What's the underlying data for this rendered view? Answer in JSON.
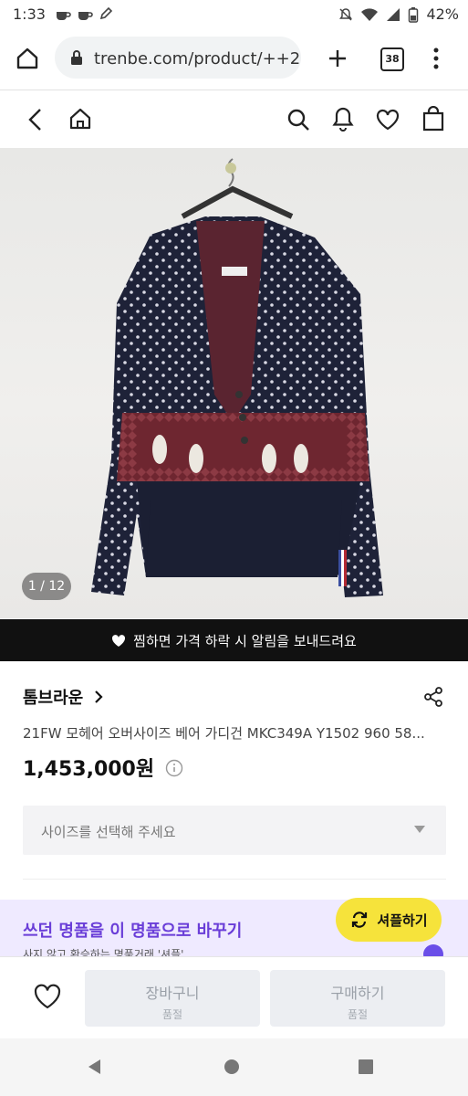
{
  "status_bar": {
    "time": "1:33",
    "battery": "42%",
    "left_icons": [
      "coffee-icon",
      "coffee-icon",
      "pencil-icon"
    ],
    "right_icons": [
      "mute-icon",
      "wifi-icon",
      "signal-icon",
      "battery-icon"
    ]
  },
  "browser": {
    "url": "trenbe.com/product/++2",
    "tab_count": "38"
  },
  "product": {
    "image_counter": "1 / 12",
    "notify_text": "찜하면 가격 하락 시 알림을 보내드려요",
    "brand": "톰브라운",
    "name": "21FW 모헤어 오버사이즈 베어 가디건 MKC349A Y1502 960 58...",
    "price": "1,453,000원",
    "size_placeholder": "사이즈를 선택해 주세요"
  },
  "promo": {
    "title": "쓰던 명품을 이 명품으로 바꾸기",
    "subtitle": "사지 않고 환승하는 명품거래 '셔플'",
    "shuffle_button": "셔플하기"
  },
  "bottom_bar": {
    "cart_label": "장바구니",
    "cart_status": "품절",
    "buy_label": "구매하기",
    "buy_status": "품절"
  },
  "colors": {
    "accent_purple": "#6a3ed8",
    "promo_bg": "#efeaff",
    "shuffle_yellow": "#f6e33b",
    "banner_black": "#111111"
  }
}
